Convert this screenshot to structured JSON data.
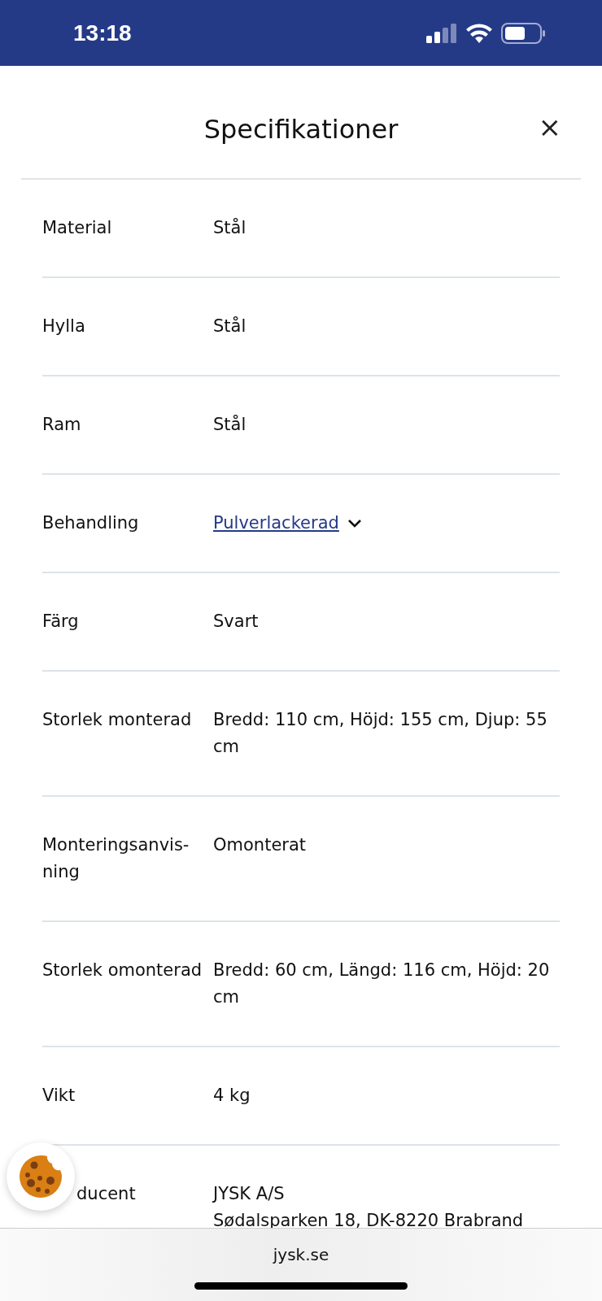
{
  "status_bar": {
    "time": "13:18"
  },
  "dialog": {
    "title": "Specifikationer",
    "close": "×"
  },
  "specs": [
    {
      "kind": "text",
      "label": "Material",
      "value": [
        "Stål"
      ]
    },
    {
      "kind": "text",
      "label": "Hylla",
      "value": [
        "Stål"
      ]
    },
    {
      "kind": "text",
      "label": "Ram",
      "value": [
        "Stål"
      ]
    },
    {
      "kind": "link",
      "label": "Behandling",
      "value": [
        "Pulverlackerad"
      ],
      "expanded": false
    },
    {
      "kind": "text",
      "label": "Färg",
      "value": [
        "Svart"
      ]
    },
    {
      "kind": "text",
      "label": "Storlek monterad",
      "value": [
        "Bredd: 110 cm, Höjd: 155 cm, Djup: 55 cm"
      ]
    },
    {
      "kind": "text",
      "label": "Monteringsanvis-ning",
      "value": [
        "Omonterat"
      ]
    },
    {
      "kind": "text",
      "label": "Storlek omonterad",
      "value": [
        "Bredd: 60 cm, Längd: 116 cm, Höjd: 20 cm"
      ]
    },
    {
      "kind": "text",
      "label": "Vikt",
      "value": [
        "4 kg"
      ]
    },
    {
      "kind": "text",
      "label": "ducent",
      "value": [
        "JYSK A/S",
        "Sødalsparken 18, DK-8220 Brabrand"
      ]
    }
  ],
  "browser_bar": {
    "url": "jysk.se"
  }
}
